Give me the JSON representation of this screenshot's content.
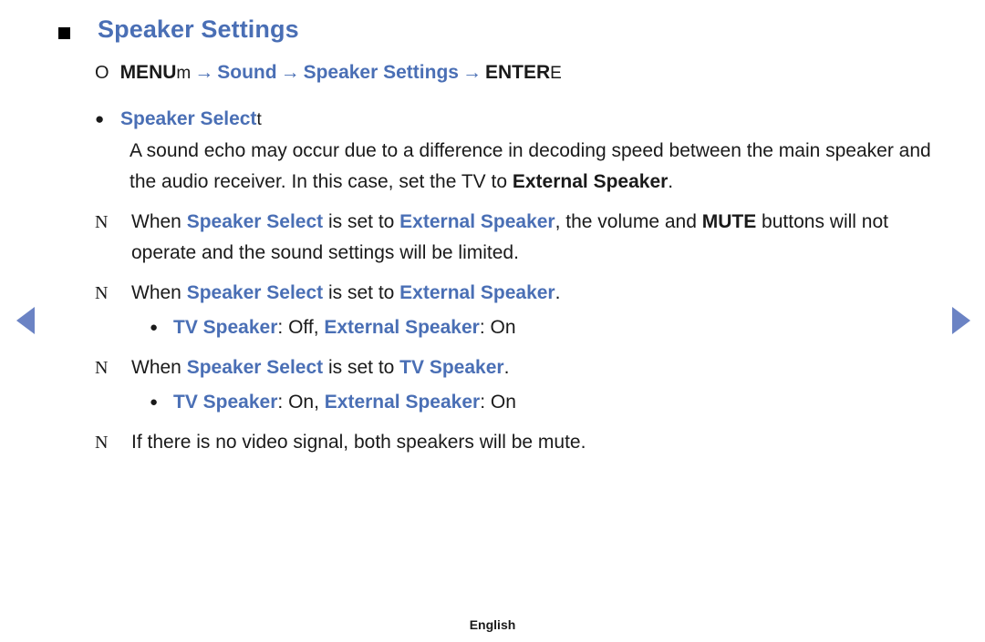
{
  "page": {
    "title": "Speaker Settings",
    "title_bullet": "square-bullet",
    "menu_path": {
      "circle_glyph": "O",
      "menu_label": "MENU",
      "menu_suffix": "m",
      "arrow": "→",
      "step1": "Sound",
      "step2": "Speaker Settings",
      "enter_label": "ENTER",
      "enter_suffix": "E"
    },
    "option": {
      "bullet": "●",
      "label": "Speaker Select",
      "suffix": "t"
    },
    "intro_paragraph": {
      "part1": "A sound echo may occur due to a difference in decoding speed between the main speaker and the audio receiver. In this case, set the TV to ",
      "bold1": "External Speaker",
      "part2": "."
    },
    "notes": [
      {
        "mark": "N",
        "segments": [
          {
            "text": "When ",
            "style": "plain"
          },
          {
            "text": "Speaker Select",
            "style": "blue-bold"
          },
          {
            "text": " is set to ",
            "style": "plain"
          },
          {
            "text": "External Speaker",
            "style": "blue-bold"
          },
          {
            "text": ", the volume and ",
            "style": "plain"
          },
          {
            "text": "MUTE",
            "style": "bold"
          },
          {
            "text": " buttons will not operate and the sound settings will be limited.",
            "style": "plain"
          }
        ]
      },
      {
        "mark": "N",
        "segments": [
          {
            "text": "When ",
            "style": "plain"
          },
          {
            "text": "Speaker Select",
            "style": "blue-bold"
          },
          {
            "text": " is set to ",
            "style": "plain"
          },
          {
            "text": "External Speaker",
            "style": "blue-bold"
          },
          {
            "text": ".",
            "style": "plain"
          }
        ],
        "sub": {
          "bullet": "●",
          "seg1": "TV Speaker",
          "seg2": ": Off, ",
          "seg3": "External Speaker",
          "seg4": ": On"
        }
      },
      {
        "mark": "N",
        "segments": [
          {
            "text": "When ",
            "style": "plain"
          },
          {
            "text": "Speaker Select",
            "style": "blue-bold"
          },
          {
            "text": " is set to ",
            "style": "plain"
          },
          {
            "text": "TV Speaker",
            "style": "blue-bold"
          },
          {
            "text": ".",
            "style": "plain"
          }
        ],
        "sub": {
          "bullet": "●",
          "seg1": "TV Speaker",
          "seg2": ": On, ",
          "seg3": "External Speaker",
          "seg4": ": On"
        }
      },
      {
        "mark": "N",
        "segments": [
          {
            "text": "If there is no video signal, both speakers will be mute.",
            "style": "plain"
          }
        ]
      }
    ],
    "nav": {
      "prev": "◀",
      "next": "▶"
    },
    "footer": "English",
    "colors": {
      "accent_blue": "#4a6fb5",
      "nav_blue": "#6b83c4",
      "text": "#1a1a1a"
    }
  }
}
